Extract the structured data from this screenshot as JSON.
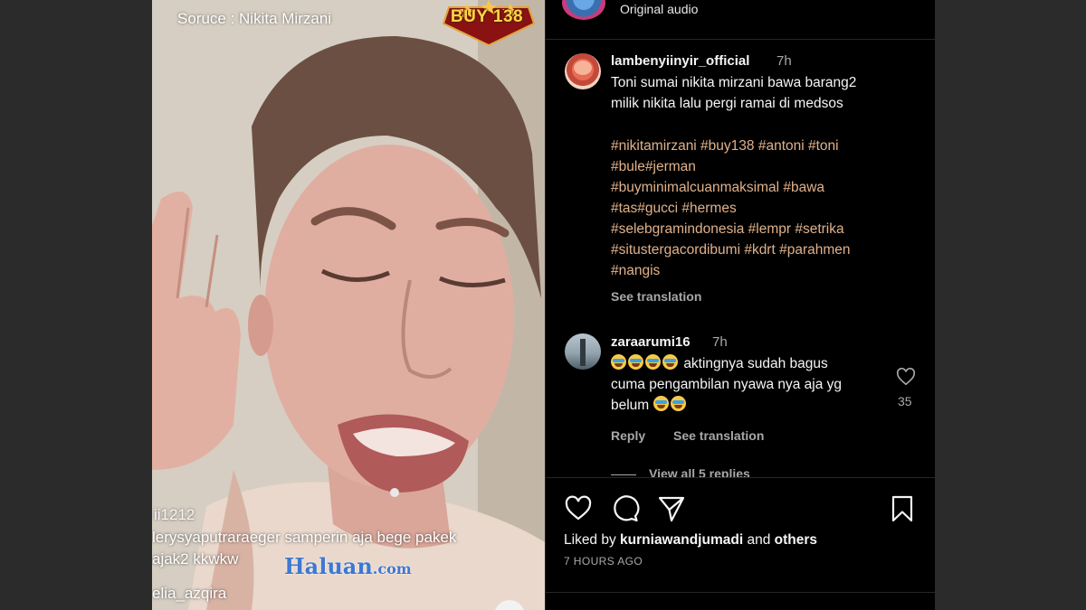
{
  "video": {
    "source_label": "Soruce : Nikita Mirzani",
    "logo_text": "BUY 138",
    "live_user_1": "ii1212",
    "live_comment_line_1": "lerysyaputraraeger samperin aja bege pakek",
    "live_comment_line_2": "ajak2 kkwkw",
    "live_user_2": "elia_azqira",
    "watermark_main": "Haluan",
    "watermark_suffix": ".com"
  },
  "post": {
    "audio_label": "Original audio",
    "caption": {
      "username": "lambenyiinyir_official",
      "time": "7h",
      "text_line_1": "Toni sumai nikita mirzani bawa barang2",
      "text_line_2": "milik nikita lalu pergi ramai di medsos",
      "hashtag_lines": [
        "#nikitamirzani #buy138 #antoni #toni",
        "#bule#jerman",
        "#buyminimalcuanmaksimal #bawa",
        "#tas#gucci #hermes",
        "#selebgramindonesia #lempr #setrika",
        "#situstergacordibumi #kdrt #parahmen",
        "#nangis"
      ],
      "see_translation": "See translation"
    },
    "comment": {
      "username": "zaraarumi16",
      "time": "7h",
      "text_line_1": "aktingnya sudah bagus",
      "text_line_2": "cuma pengambilan nyawa nya aja yg",
      "text_line_3": "belum",
      "like_count": "35",
      "reply_label": "Reply",
      "see_translation": "See translation",
      "view_replies": "View all 5 replies"
    },
    "liked_by_prefix": "Liked by",
    "liked_by_user": "kurniawandjumadi",
    "liked_by_and": "and",
    "liked_by_others": "others",
    "posted_ago": "7 HOURS AGO"
  },
  "icons": [
    "heart-icon",
    "comment-icon",
    "share-icon",
    "bookmark-icon",
    "comment-like-heart-icon"
  ],
  "colors": {
    "background": "#2b2b2b",
    "panel": "#000000",
    "hashtag": "#e0b18a",
    "muted": "#a8a8a8"
  }
}
